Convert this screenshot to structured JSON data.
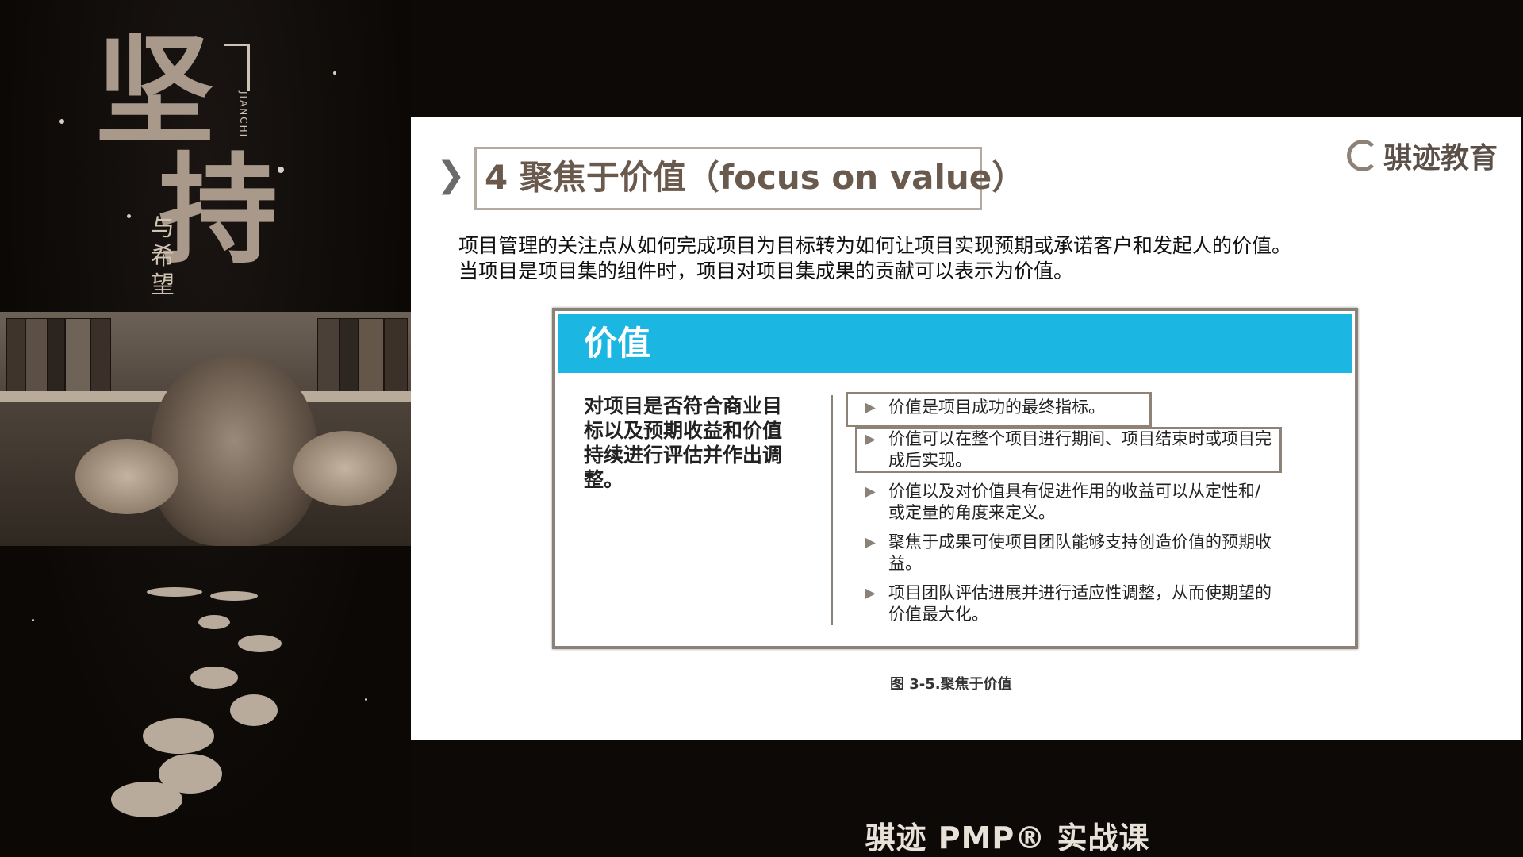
{
  "left_panel": {
    "calligraphy_big": [
      "坚",
      "持"
    ],
    "calligraphy_small": "与希望",
    "pinyin": "JIANCHI"
  },
  "slide": {
    "title": "4 聚焦于价值（focus on value）",
    "brand": "骐迹教育",
    "intro": [
      "项目管理的关注点从如何完成项目为目标转为如何让项目实现预期或承诺客户和发起人的价值。",
      "当项目是项目集的组件时，项目对项目集成果的贡献可以表示为价值。"
    ],
    "card": {
      "title": "价值",
      "left_text": "对项目是否符合商业目标以及预期收益和价值持续进行评估并作出调整。",
      "bullets": [
        "价值是项目成功的最终指标。",
        "价值可以在整个项目进行期间、项目结束时或项目完成后实现。",
        "价值以及对价值具有促进作用的收益可以从定性和/或定量的角度来定义。",
        "聚焦于成果可使项目团队能够支持创造价值的预期收益。",
        "项目团队评估进展并进行适应性调整，从而使期望的价值最大化。"
      ]
    },
    "caption": "图 3-5.聚焦于价值"
  },
  "footer": {
    "course_title": "骐迹 PMP® 实战课"
  },
  "colors": {
    "card_header": "#1cb6e3",
    "highlight_border": "#8f8277",
    "background": "#0c0907"
  },
  "icons": [
    "chevron-right-icon",
    "brand-logo-icon",
    "triangle-bullet-icon"
  ]
}
